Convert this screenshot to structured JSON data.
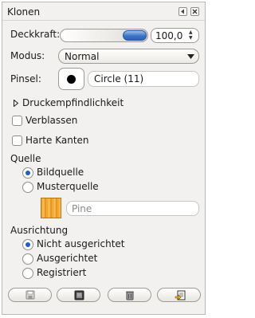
{
  "dialog": {
    "title": "Klonen",
    "header_icons": [
      "tab-menu-icon",
      "close-icon"
    ]
  },
  "opacity": {
    "label": "Deckkraft:",
    "value": "100,0",
    "fraction": 1.0
  },
  "mode": {
    "label": "Modus:",
    "value": "Normal"
  },
  "brush": {
    "label": "Pinsel:",
    "name": "Circle (11)"
  },
  "pressure": {
    "label": "Druckempfindlichkeit",
    "expanded": false
  },
  "fade": {
    "label": "Verblassen",
    "checked": false
  },
  "hard_edges": {
    "label": "Harte Kanten",
    "checked": false
  },
  "source": {
    "heading": "Quelle",
    "options": [
      "Bildquelle",
      "Musterquelle"
    ],
    "selected": "Bildquelle",
    "pattern_name": "Pine"
  },
  "alignment": {
    "heading": "Ausrichtung",
    "options": [
      "Nicht ausgerichtet",
      "Ausgerichtet",
      "Registriert"
    ],
    "selected": "Nicht ausgerichtet"
  },
  "bottom_buttons": [
    "save-icon",
    "restore-icon",
    "delete-icon",
    "reset-icon"
  ],
  "colors": {
    "accent": "#2a63b7",
    "panel_bg": "#f2f1ef",
    "pattern": "#f3a12b"
  }
}
